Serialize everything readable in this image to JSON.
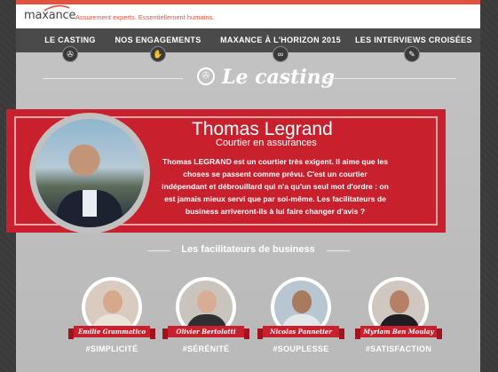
{
  "brand": {
    "logo": "maxance",
    "tagline": "Assurement experts. Essentiellement humains."
  },
  "nav": [
    {
      "label": "LE CASTING",
      "icon": "film-reel-icon"
    },
    {
      "label": "NOS ENGAGEMENTS",
      "icon": "handshake-icon"
    },
    {
      "label": "MAXANCE À L'HORIZON 2015",
      "icon": "binoculars-icon"
    },
    {
      "label": "LES INTERVIEWS CROISÉES",
      "icon": "microphone-icon"
    }
  ],
  "section": {
    "title": "Le casting",
    "icon": "film-reel-icon"
  },
  "profile": {
    "name": "Thomas Legrand",
    "role": "Courtier en assurances",
    "description": "Thomas LEGRAND est un courtier très exigent. Il aime que les choses se passent comme prévu. C'est un courtier indépendant et débrouillard qui n'a qu'un seul mot d'ordre : on est jamais mieux servi que par soi-même. Les facilitateurs de business arriveront-ils à lui faire changer d'avis ?"
  },
  "facilitators_title": "Les facilitateurs de business",
  "facilitators": [
    {
      "name": "Emilie Grammatico",
      "tag": "#SIMPLICITÉ"
    },
    {
      "name": "Olivier Bertolotti",
      "tag": "#SÉRÉNITÉ"
    },
    {
      "name": "Nicolas Pannetier",
      "tag": "#SOUPLESSE"
    },
    {
      "name": "Myriam Ben Moulay",
      "tag": "#SATISFACTION"
    }
  ],
  "colors": {
    "accent": "#c8202d",
    "topline": "#e0533e",
    "nav": "#4a4a4a",
    "background": "#c4c4c4"
  }
}
